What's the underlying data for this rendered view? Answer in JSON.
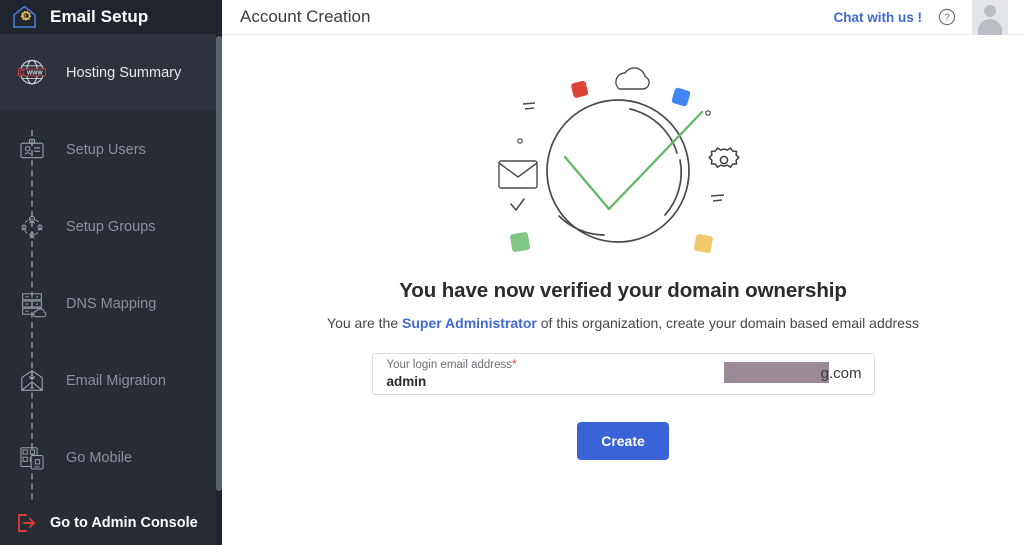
{
  "sidebar": {
    "brand": "Email Setup",
    "logo_icon": "house-gear-logo-icon",
    "items": [
      {
        "label": "Hosting Summary",
        "icon": "globe-www-icon",
        "active": true
      },
      {
        "label": "Setup Users",
        "icon": "id-card-user-icon",
        "active": false
      },
      {
        "label": "Setup Groups",
        "icon": "user-group-network-icon",
        "active": false
      },
      {
        "label": "DNS Mapping",
        "icon": "server-cloud-icon",
        "active": false
      },
      {
        "label": "Email Migration",
        "icon": "envelope-download-icon",
        "active": false
      },
      {
        "label": "Go Mobile",
        "icon": "mobile-qr-icon",
        "active": false
      }
    ],
    "admin_console": {
      "label": "Go to Admin Console",
      "icon": "exit-arrow-icon"
    }
  },
  "topbar": {
    "title": "Account Creation",
    "chat_label": "Chat with us !",
    "help_icon": "question-circle-icon",
    "avatar_icon": "user-avatar-placeholder"
  },
  "main": {
    "illustration_icon": "verified-check-circle-illustration",
    "headline": "You have now verified your domain ownership",
    "subline_before": "You are the ",
    "subline_highlight": "Super Administrator",
    "subline_after": " of this organization, create your domain based email address",
    "field": {
      "label": "Your login email address",
      "required_mark": "*",
      "value": "admin",
      "placeholder": "admin",
      "domain_redacted": true,
      "domain_suffix": "g.com"
    },
    "create_label": "Create"
  },
  "colors": {
    "sidebar_bg": "#272c35",
    "sidebar_header_bg": "#20242c",
    "accent_blue": "#3b63d8",
    "link_blue": "#4169d6",
    "check_green": "#63b863",
    "danger_red": "#e03b3b",
    "redaction": "#9a8a95",
    "square_red": "#db4437",
    "square_blue": "#4285f4",
    "square_green": "#81c784",
    "square_yellow": "#f0c96c"
  }
}
